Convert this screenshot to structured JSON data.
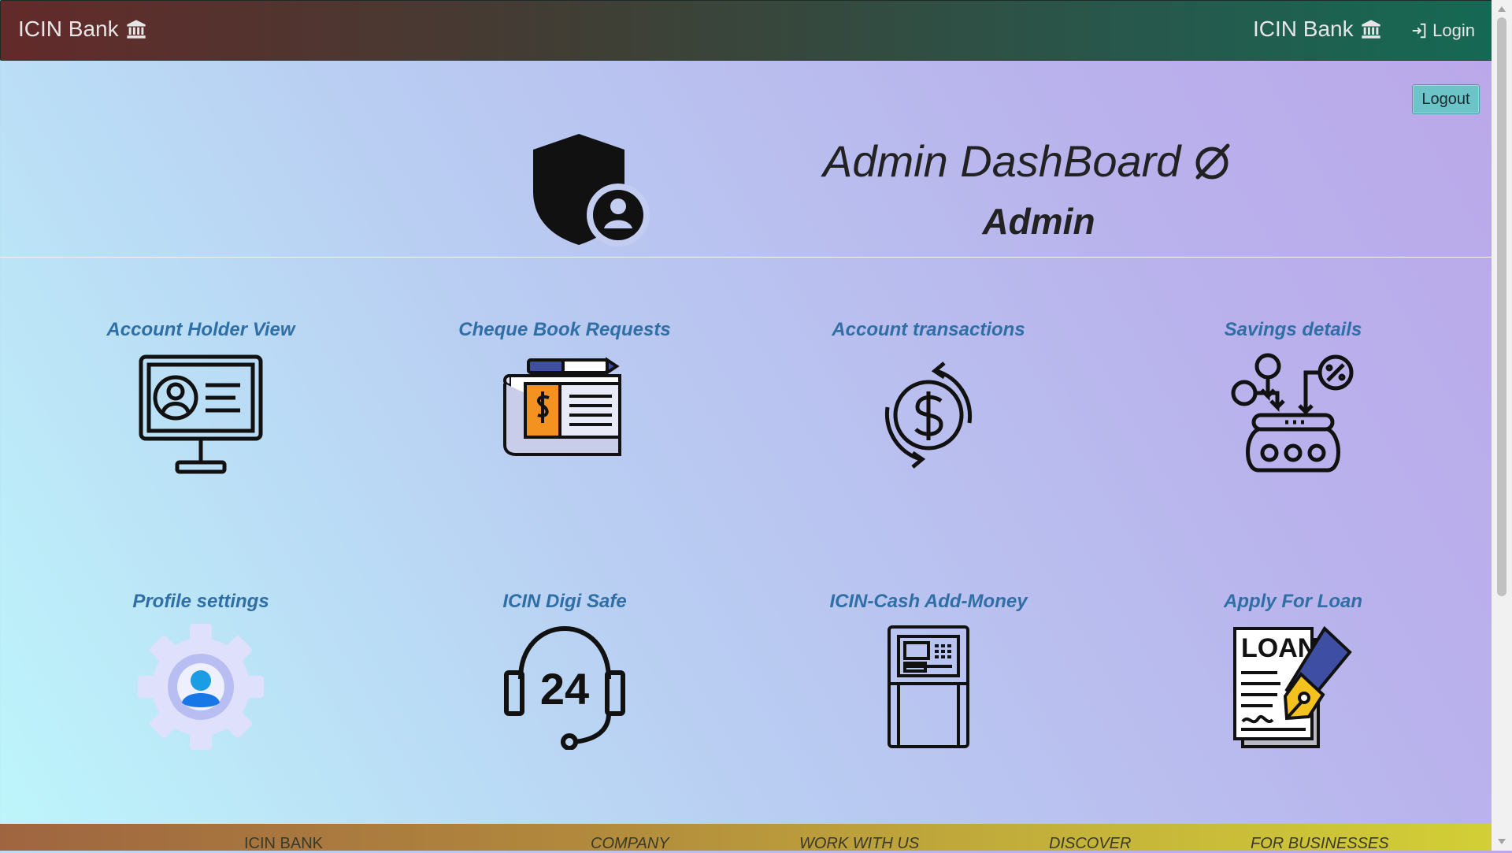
{
  "navbar": {
    "brand_left": "ICIN Bank",
    "brand_right": "ICIN Bank",
    "login_label": "Login"
  },
  "header": {
    "logout_label": "Logout",
    "title": "Admin DashBoard",
    "subtitle": "Admin"
  },
  "cards": [
    {
      "label": "Account Holder View",
      "icon": "monitor-profile-icon"
    },
    {
      "label": "Cheque Book Requests",
      "icon": "cheque-book-icon"
    },
    {
      "label": "Account transactions",
      "icon": "dollar-exchange-icon"
    },
    {
      "label": "Savings details",
      "icon": "savings-pot-icon"
    },
    {
      "label": "Profile settings",
      "icon": "profile-gear-icon"
    },
    {
      "label": "ICIN Digi Safe",
      "icon": "headset-24-icon"
    },
    {
      "label": "ICIN-Cash Add-Money",
      "icon": "atm-machine-icon"
    },
    {
      "label": "Apply For Loan",
      "icon": "loan-document-icon"
    }
  ],
  "footer": {
    "col1": "ICIN BANK",
    "col2": "COMPANY",
    "col3": "WORK WITH US",
    "col4": "DISCOVER",
    "col5": "FOR BUSINESSES"
  },
  "colors": {
    "link": "#2f6fa6",
    "logout_button": "#6cc3c8"
  }
}
